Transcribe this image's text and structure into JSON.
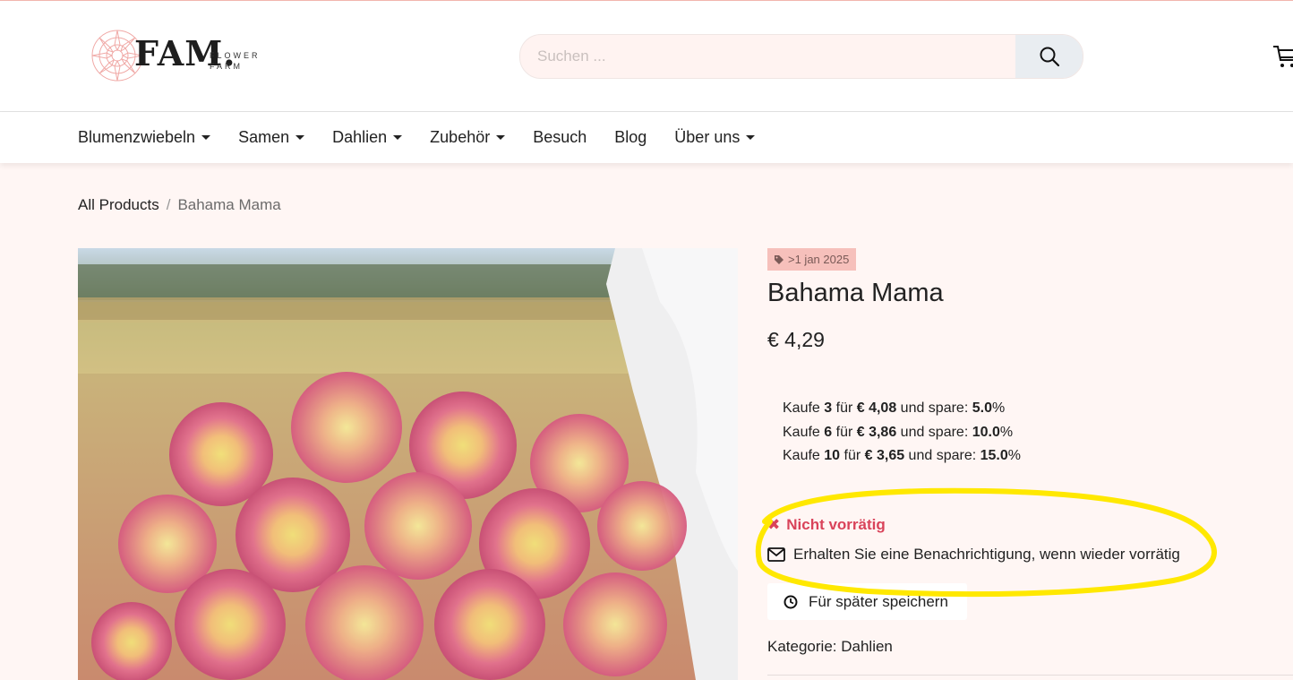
{
  "brand": {
    "logo_word": "FAM.",
    "logo_sub_1": "FLOWER",
    "logo_sub_2": "FARM",
    "logo_icon": "dahlia-flower-icon"
  },
  "search": {
    "placeholder": "Suchen ...",
    "value": "",
    "button_icon": "search-icon"
  },
  "cart": {
    "icon": "shopping-cart-icon"
  },
  "nav": {
    "items": [
      {
        "label": "Blumenzwiebeln",
        "dropdown": true
      },
      {
        "label": "Samen",
        "dropdown": true
      },
      {
        "label": "Dahlien",
        "dropdown": true
      },
      {
        "label": "Zubehör",
        "dropdown": true
      },
      {
        "label": "Besuch",
        "dropdown": false
      },
      {
        "label": "Blog",
        "dropdown": false
      },
      {
        "label": "Über uns",
        "dropdown": true
      }
    ]
  },
  "breadcrumb": {
    "root": "All Products",
    "separator": "/",
    "current": "Bahama Mama"
  },
  "product": {
    "tag": ">1 jan 2025",
    "tag_icon": "tag-icon",
    "name": "Bahama Mama",
    "price": "€ 4,29",
    "tiers": [
      {
        "pre": "Kaufe ",
        "qty": "3",
        "mid": " für ",
        "price": "€ 4,08",
        "post": " und spare: ",
        "pct": "5.0",
        "pct_sign": "%"
      },
      {
        "pre": "Kaufe ",
        "qty": "6",
        "mid": " für ",
        "price": "€ 3,86",
        "post": " und spare: ",
        "pct": "10.0",
        "pct_sign": "%"
      },
      {
        "pre": "Kaufe ",
        "qty": "10",
        "mid": " für ",
        "price": "€ 3,65",
        "post": " und spare: ",
        "pct": "15.0",
        "pct_sign": "%"
      }
    ],
    "stock_status": "Nicht vorrätig",
    "stock_icon_glyph": "✖",
    "notify_label": "Erhalten Sie eine Benachrichtigung, wenn wieder vorrätig",
    "save_label": "Für später speichern",
    "category_label": "Kategorie:",
    "category_value": "Dahlien"
  },
  "colors": {
    "page_bg": "#fff6f4",
    "tag_bg": "#f6c0bb",
    "stock_red": "#d9435a",
    "highlight_yellow": "#ffe800",
    "search_bg": "#fff3f1",
    "search_btn_bg": "#e9edf1"
  }
}
